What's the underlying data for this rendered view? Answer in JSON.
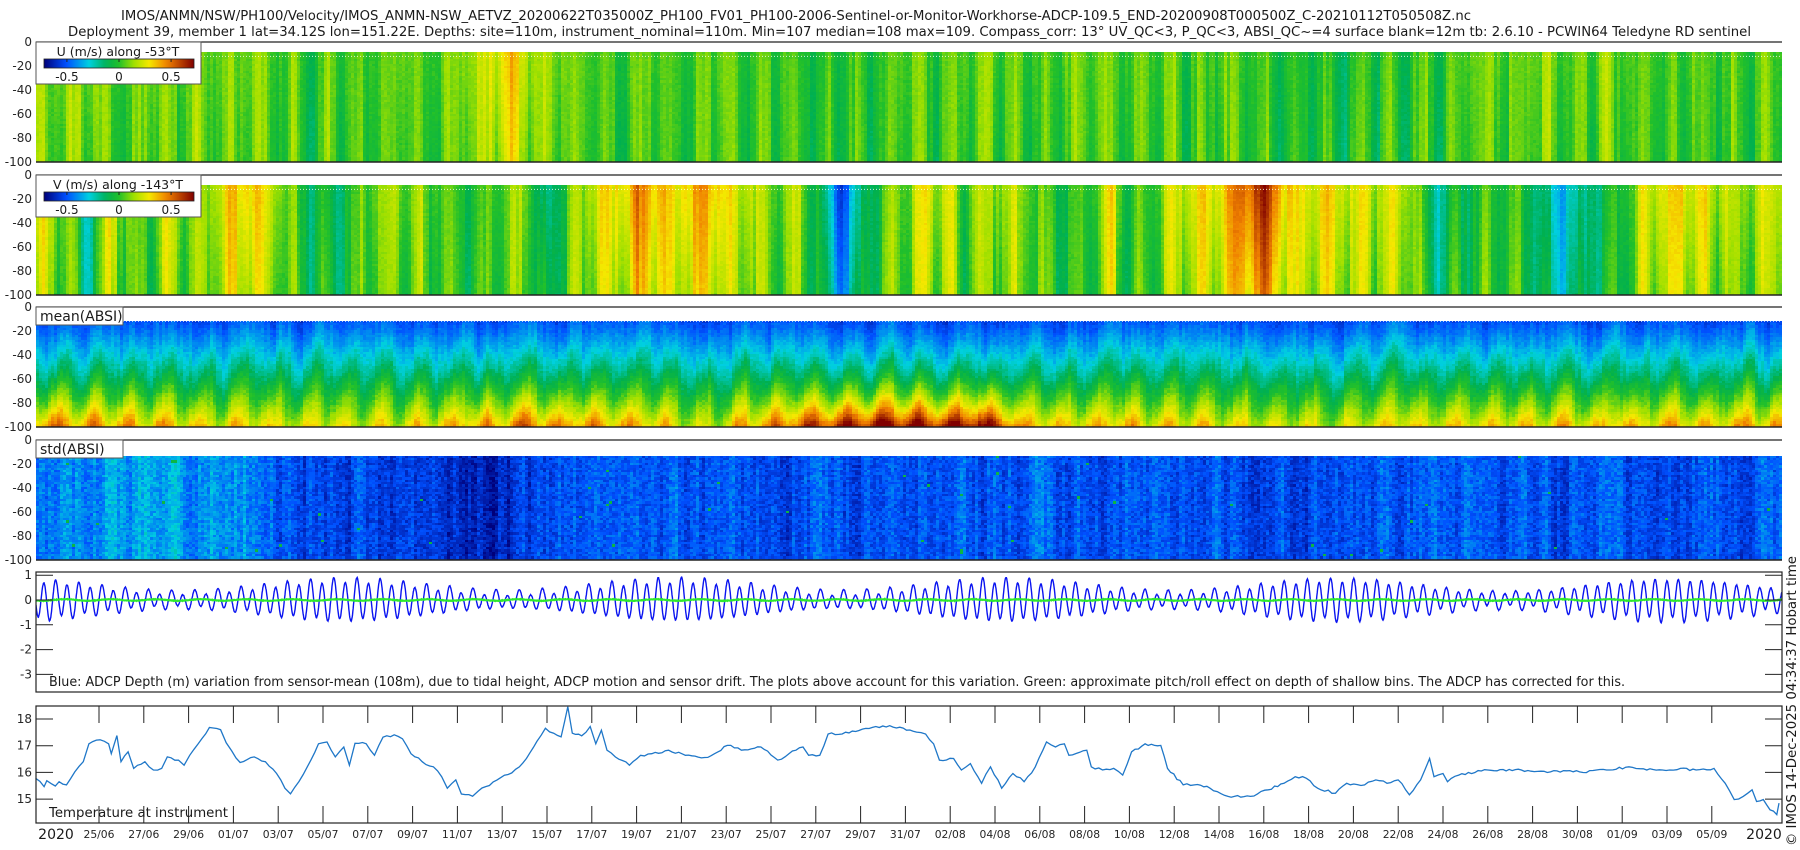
{
  "header": {
    "title_line1": "IMOS/ANMN/NSW/PH100/Velocity/IMOS_ANMN-NSW_AETVZ_20200622T035000Z_PH100_FV01_PH100-2006-Sentinel-or-Monitor-Workhorse-ADCP-109.5_END-20200908T000500Z_C-20210112T050508Z.nc",
    "title_line2": "Deployment 39, member 1 lat=34.12S lon=151.22E. Depths: site=110m, instrument_nominal=110m. Min=107 median=108 max=109. Compass_corr: 13° UV_QC<3, P_QC<3, ABSI_QC~=4 surface blank=12m tb: 2.6.10 - PCWIN64 Teledyne RD sentinel"
  },
  "footer": {
    "credit": "© IMOS 14-Dec-2025 04:34:37 Hobart time"
  },
  "colors": {
    "depth_line": "#0a14f0",
    "pitch_roll_line": "#2ee82e",
    "temperature_line": "#1f77c8"
  },
  "chart_data": [
    {
      "type": "heatmap",
      "id": "u",
      "title": "U (m/s) along -53°T",
      "yticks": [
        "0",
        "-20",
        "-40",
        "-60",
        "-80",
        "-100"
      ],
      "ylim": [
        -100,
        0
      ],
      "clim": [
        -0.72,
        0.72
      ],
      "colorbar_ticks": [
        "-0.5",
        "0",
        "0.5"
      ],
      "surface_blank_m": 12,
      "depth_mean_nodes": [
        [
          -2.8,
          0.12
        ],
        [
          0,
          0.1
        ],
        [
          5,
          0.08
        ],
        [
          10,
          0.05
        ],
        [
          16,
          0.1
        ],
        [
          18.5,
          0.35
        ],
        [
          19.5,
          0.12
        ],
        [
          22,
          0.05
        ],
        [
          25,
          0.08
        ],
        [
          32,
          0.0
        ],
        [
          40,
          0.08
        ],
        [
          50,
          0.05
        ],
        [
          56,
          -0.04
        ],
        [
          60,
          0.05
        ],
        [
          66,
          0.1
        ],
        [
          70,
          0.05
        ],
        [
          75.2,
          0.08
        ]
      ]
    },
    {
      "type": "heatmap",
      "id": "v",
      "title": "V (m/s) along -143°T",
      "yticks": [
        "0",
        "-20",
        "-40",
        "-60",
        "-80",
        "-100"
      ],
      "ylim": [
        -100,
        0
      ],
      "clim": [
        -0.72,
        0.72
      ],
      "colorbar_ticks": [
        "-0.5",
        "0",
        "0.5"
      ],
      "surface_blank_m": 12,
      "depth_mean_nodes": [
        [
          -2.8,
          0.3
        ],
        [
          -1.1,
          0.05
        ],
        [
          -0.6,
          -0.15
        ],
        [
          0.4,
          0.25
        ],
        [
          1.9,
          0.0
        ],
        [
          2.9,
          0.2
        ],
        [
          4.4,
          0.05
        ],
        [
          6.4,
          0.35
        ],
        [
          7.7,
          0.25
        ],
        [
          8.9,
          -0.05
        ],
        [
          10.2,
          -0.12
        ],
        [
          11.4,
          0.0
        ],
        [
          13.2,
          0.2
        ],
        [
          14.9,
          0.05
        ],
        [
          16.9,
          0.0
        ],
        [
          18.9,
          0.15
        ],
        [
          19.7,
          -0.3
        ],
        [
          20.9,
          0.0
        ],
        [
          22.2,
          0.25
        ],
        [
          23.9,
          0.45
        ],
        [
          25.4,
          0.25
        ],
        [
          26.9,
          0.45
        ],
        [
          28.4,
          0.25
        ],
        [
          29.9,
          0.1
        ],
        [
          31.2,
          0.2
        ],
        [
          32.4,
          -0.2
        ],
        [
          33.0,
          -0.55
        ],
        [
          33.9,
          -0.2
        ],
        [
          35.2,
          0.05
        ],
        [
          35.8,
          0.05
        ],
        [
          37.0,
          0.25
        ],
        [
          38.5,
          0.05
        ],
        [
          40.0,
          0.2
        ],
        [
          42.1,
          0.0
        ],
        [
          43.1,
          -0.05
        ],
        [
          45.1,
          0.25
        ],
        [
          46.1,
          -0.05
        ],
        [
          48.4,
          0.25
        ],
        [
          50.1,
          0.3
        ],
        [
          51.9,
          0.7
        ],
        [
          53.4,
          0.25
        ],
        [
          54.9,
          0.3
        ],
        [
          56.5,
          0.2
        ],
        [
          58.0,
          0.2
        ],
        [
          59.5,
          -0.15
        ],
        [
          61.0,
          -0.1
        ],
        [
          63.5,
          0.0
        ],
        [
          65.3,
          -0.3
        ],
        [
          67.3,
          -0.05
        ],
        [
          69.6,
          0.3
        ],
        [
          71.6,
          0.3
        ],
        [
          73.1,
          0.2
        ],
        [
          75.2,
          0.2
        ]
      ]
    },
    {
      "type": "heatmap",
      "id": "absi_mean",
      "title": "mean(ABSI)",
      "yticks": [
        "0",
        "-20",
        "-40",
        "-60",
        "-80",
        "-100"
      ],
      "ylim": [
        -100,
        0
      ],
      "surface_blank_m": 12,
      "near_bed_intensity_nodes": [
        [
          -2.8,
          0.15
        ],
        [
          5,
          0.05
        ],
        [
          12,
          0.0
        ],
        [
          19,
          0.15
        ],
        [
          23,
          0.1
        ],
        [
          27,
          0.0
        ],
        [
          33.5,
          0.3
        ],
        [
          40,
          0.3
        ],
        [
          41,
          0.1
        ],
        [
          55,
          0.0
        ],
        [
          60,
          0.05
        ],
        [
          75.2,
          0.1
        ]
      ]
    },
    {
      "type": "heatmap",
      "id": "absi_std",
      "title": "std(ABSI)",
      "yticks": [
        "0",
        "-20",
        "-40",
        "-60",
        "-80",
        "-100"
      ],
      "ylim": [
        -100,
        0
      ],
      "surface_blank_m": 12,
      "intensity_nodes": [
        [
          -2.8,
          0.05
        ],
        [
          2,
          0.12
        ],
        [
          6.5,
          0.12
        ],
        [
          7,
          0.03
        ],
        [
          16,
          -0.05
        ],
        [
          18,
          -0.05
        ],
        [
          20,
          0.02
        ],
        [
          75.2,
          0.02
        ]
      ]
    },
    {
      "type": "line",
      "id": "depth_variation",
      "yticks": [
        "1",
        "0",
        "-1",
        "-2",
        "-3"
      ],
      "ylim": [
        -3.72,
        1.12
      ],
      "caption": "Blue: ADCP Depth (m) variation from sensor-mean (108m), due to tidal height, ADCP motion and sensor drift. The plots above account for this variation. Green: approximate pitch/roll effect on depth of shallow bins. The ADCP has corrected for this.",
      "series": [
        {
          "name": "ADCP depth variation (m)",
          "color": "#0a14f0",
          "tidal_period_days": 0.5175,
          "amplitude_mean_m": 0.55,
          "amplitude_springneap_m": 0.25,
          "springneap_period_days": 14.77,
          "spring_peak_day": 11
        },
        {
          "name": "pitch/roll depth effect (m)",
          "color": "#2ee82e",
          "value": 0.0
        }
      ]
    },
    {
      "type": "line",
      "id": "temperature",
      "label": "Temperature at instrument",
      "yticks": [
        "18",
        "17",
        "16",
        "15"
      ],
      "ylim": [
        14.1,
        18.5
      ],
      "x": [
        -2.83,
        -2.45,
        -2.33,
        -1.95,
        -1.78,
        -1.45,
        -1.08,
        -0.7,
        -0.45,
        0.05,
        0.43,
        0.55,
        0.8,
        0.98,
        1.3,
        1.55,
        2.05,
        2.43,
        2.8,
        3.05,
        3.55,
        3.8,
        4.05,
        4.43,
        4.93,
        5.43,
        5.68,
        5.93,
        6.3,
        6.93,
        7.43,
        7.93,
        8.3,
        8.55,
        8.93,
        9.3,
        9.8,
        10.18,
        10.55,
        10.93,
        11.18,
        11.43,
        11.93,
        12.3,
        12.68,
        13.18,
        13.55,
        13.93,
        14.43,
        14.93,
        15.3,
        15.55,
        15.93,
        16.18,
        16.68,
        16.93,
        17.43,
        17.93,
        18.43,
        18.93,
        19.55,
        19.93,
        20.3,
        20.63,
        20.93,
        21.13,
        21.55,
        21.93,
        22.18,
        22.43,
        22.68,
        23.05,
        23.68,
        24.18,
        24.68,
        25.43,
        26.18,
        27.18,
        28.05,
        28.68,
        29.55,
        30.3,
        30.8,
        31.43,
        31.68,
        32.18,
        32.55,
        33.18,
        33.93,
        34.68,
        35.3,
        36.5,
        36.9,
        37.26,
        37.52,
        38.15,
        38.5,
        38.9,
        39.4,
        39.8,
        40.3,
        40.8,
        41.3,
        41.8,
        42.3,
        42.7,
        43.1,
        43.3,
        44.1,
        44.3,
        44.8,
        45.3,
        45.7,
        46.1,
        46.7,
        47.4,
        47.7,
        48.4,
        48.9,
        49.6,
        50.4,
        51.4,
        52.2,
        52.9,
        53.4,
        53.9,
        54.4,
        55.2,
        55.7,
        56.5,
        57.0,
        57.5,
        58.0,
        58.5,
        59.0,
        59.4,
        59.6,
        60.0,
        60.2,
        60.7,
        62.0,
        63.5,
        64.8,
        66.1,
        67.3,
        68.3,
        69.1,
        69.8,
        70.6,
        71.3,
        72.1,
        72.6,
        73.0,
        73.4,
        73.8,
        74.0,
        74.3,
        74.6,
        74.9,
        75.0
      ],
      "y": [
        15.78,
        15.47,
        15.69,
        15.49,
        15.65,
        15.53,
        16.02,
        16.4,
        17.07,
        17.22,
        17.07,
        16.7,
        17.38,
        16.4,
        16.77,
        16.15,
        16.4,
        16.09,
        16.15,
        16.58,
        16.46,
        16.27,
        16.64,
        17.07,
        17.68,
        17.6,
        17.11,
        16.8,
        16.37,
        16.58,
        16.4,
        15.96,
        15.41,
        15.2,
        15.66,
        16.21,
        17.07,
        17.14,
        16.58,
        16.95,
        16.27,
        17.09,
        17.07,
        16.64,
        17.32,
        17.41,
        17.26,
        16.7,
        16.4,
        16.21,
        15.84,
        15.41,
        15.72,
        15.19,
        15.11,
        15.3,
        15.51,
        15.8,
        15.98,
        16.36,
        17.16,
        17.65,
        17.47,
        17.33,
        18.46,
        17.47,
        17.37,
        17.72,
        17.07,
        17.58,
        16.83,
        16.58,
        16.27,
        16.64,
        16.7,
        16.83,
        16.64,
        16.56,
        17.01,
        16.83,
        16.95,
        16.46,
        16.7,
        16.95,
        16.64,
        16.64,
        17.44,
        17.44,
        17.57,
        17.72,
        17.75,
        17.51,
        17.44,
        17.07,
        16.46,
        16.52,
        16.09,
        16.33,
        15.59,
        16.21,
        15.41,
        15.96,
        15.65,
        16.21,
        17.14,
        16.95,
        17.07,
        16.64,
        16.83,
        16.21,
        16.09,
        16.15,
        15.9,
        16.77,
        17.07,
        17.01,
        16.15,
        15.53,
        15.53,
        15.41,
        15.1,
        15.1,
        15.35,
        15.59,
        15.84,
        15.78,
        15.41,
        15.22,
        15.59,
        15.53,
        15.72,
        15.59,
        15.72,
        15.16,
        15.72,
        16.52,
        15.84,
        15.96,
        15.65,
        15.9,
        16.09,
        16.09,
        16.02,
        16.02,
        16.09,
        16.21,
        16.09,
        16.09,
        16.15,
        16.09,
        16.15,
        15.59,
        14.98,
        15.1,
        15.35,
        14.91,
        14.98,
        14.6,
        14.42,
        14.85
      ]
    }
  ],
  "x_axis": {
    "year_label_start": "2020",
    "year_label_end": "2020",
    "tick_labels": [
      "25/06",
      "27/06",
      "29/06",
      "01/07",
      "03/07",
      "05/07",
      "07/07",
      "09/07",
      "11/07",
      "13/07",
      "15/07",
      "17/07",
      "19/07",
      "21/07",
      "23/07",
      "25/07",
      "27/07",
      "29/07",
      "31/07",
      "02/08",
      "04/08",
      "06/08",
      "08/08",
      "10/08",
      "12/08",
      "14/08",
      "16/08",
      "18/08",
      "20/08",
      "22/08",
      "24/08",
      "26/08",
      "28/08",
      "30/08",
      "01/09",
      "03/09",
      "05/09"
    ],
    "tick_interval_days": 2
  }
}
